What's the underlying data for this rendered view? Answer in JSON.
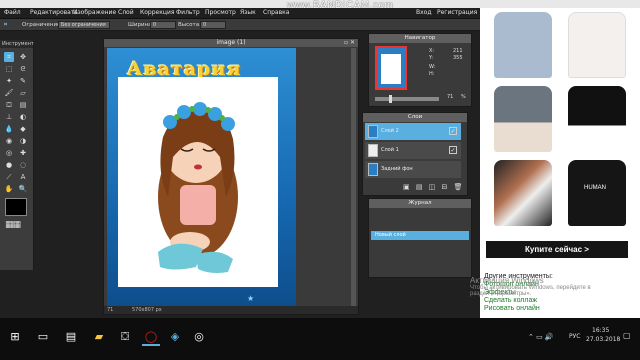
{
  "watermark": "www.BANDICAM.com",
  "menu": {
    "left": [
      "Файл",
      "Редактировать",
      "Изображение",
      "Слой",
      "Коррекция",
      "Фильтр",
      "Просмотр",
      "Язык",
      "Справка"
    ],
    "login": "Вход",
    "register": "Регистрация"
  },
  "options": {
    "constraint_label": "Ограничение:",
    "constraint_value": "Без ограничения",
    "width_label": "Ширина:",
    "width_value": "0",
    "height_label": "Высота:",
    "height_value": "0"
  },
  "tools": {
    "title": "Инструмент"
  },
  "canvas": {
    "title": "image (1)",
    "logo_text": "Аватария",
    "zoom": "71",
    "dimensions": "570x807 px"
  },
  "navigator": {
    "title": "Навигатор",
    "x_label": "X:",
    "x_value": "211",
    "y_label": "Y:",
    "y_value": "355",
    "w_label": "W:",
    "h_label": "H:",
    "zoom": "71",
    "zoom_unit": "%"
  },
  "layers": {
    "title": "Слои",
    "items": [
      {
        "name": "Слой 2",
        "selected": true
      },
      {
        "name": "Слой 1",
        "selected": false
      },
      {
        "name": "Задний фон",
        "selected": false
      }
    ]
  },
  "history": {
    "title": "Журнал",
    "items": [
      "Новый слой"
    ]
  },
  "ad": {
    "button": "Купите сейчас >",
    "sweatshirt_text": "HUMAN",
    "links_title": "Другие инструменты:",
    "links": [
      "Фотошоп онлайн",
      "Эффекты",
      "Сделать коллаж",
      "Рисовать онлайн"
    ]
  },
  "windows_activation": {
    "line1": "Активация Windows",
    "line2": "Чтобы активировать Windows, перейдите в",
    "line3": "раздел «Параметры»."
  },
  "taskbar": {
    "lang": "РУС",
    "time": "16:35",
    "date": "27.03.2018"
  },
  "colors": {
    "accent": "#59b0e0",
    "canvas_blue": "#1e7cc8"
  }
}
